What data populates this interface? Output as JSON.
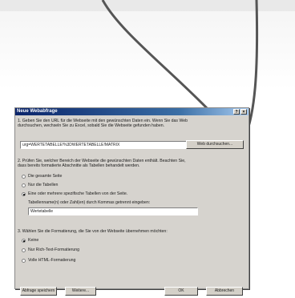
{
  "dialog": {
    "title": "Neue Webabfrage",
    "help_label": "?",
    "close_label": "×",
    "step1_line1": "1. Geben Sie den URL für die Webseite mit den gewünschten Daten ein. Wenn Sie das Web",
    "step1_line2": "durchsuchen, wechseln Sie zu Excel, sobald Sie die Webseite gefunden haben.",
    "url_value": "urg=WERTETABELLE!%3DWERTETABELLE!MATRIX",
    "browse_button": "Web durchsuchen...",
    "step2_line1": "2. Prüfen Sie, welcher Bereich der Webseite die gewünschten Daten enthält. Beachten Sie,",
    "step2_line2": "dass bereits formatierte Abschnitte als Tabellen behandelt werden.",
    "option_whole_page": "Die gesamte Seite",
    "option_tables_only": "Nur die Tabellen",
    "option_specific_tables": "Eine oder mehrere spezifische Tabellen von der Seite.",
    "table_names_label": "Tabellenname(n) oder Zahl(en) durch Kommas getrennt eingeben:",
    "table_names_value": "Wertetabelle",
    "step3_line": "3. Wählen Sie die Formatierung, die Sie von der Webseite übernehmen möchten:",
    "format_none": "Keine",
    "format_rich_text": "Nur Rich-Text-Formatierung",
    "format_full_html": "Volle HTML-Formatierung",
    "save_query_button": "Abfrage speichern",
    "advanced_button": "Weitere...",
    "ok_button": "OK",
    "cancel_button": "Abbrechen"
  },
  "colors": {
    "titlebar_start": "#0a246a",
    "titlebar_end": "#a6caf0",
    "dialog_face": "#d6d3ce",
    "annotation_line": "#555555"
  }
}
